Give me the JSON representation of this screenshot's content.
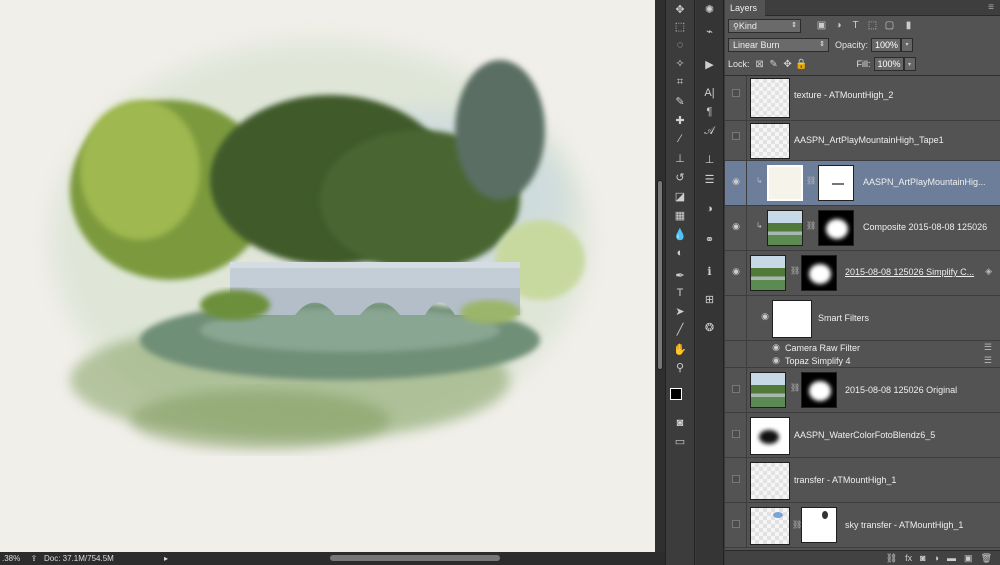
{
  "status": {
    "zoom": ".38%",
    "doc": "Doc: 37.1M/754.5M"
  },
  "layers_panel": {
    "tab_label": "Layers",
    "filter_kind": "Kind",
    "blend_mode": "Linear Burn",
    "opacity_label": "Opacity:",
    "opacity_value": "100%",
    "lock_label": "Lock:",
    "fill_label": "Fill:",
    "fill_value": "100%",
    "layers": [
      {
        "name": "texture - ATMountHigh_2",
        "visible": false
      },
      {
        "name": "AASPN_ArtPlayMountainHigh_Tape1",
        "visible": false
      },
      {
        "name": "AASPN_ArtPlayMountainHig...",
        "visible": true,
        "selected": true
      },
      {
        "name": "Composite 2015-08-08 125026",
        "visible": true
      },
      {
        "name": "2015-08-08 125026 Simplify C...",
        "visible": true
      },
      {
        "name": "Smart Filters",
        "visible": true
      },
      {
        "name": "Camera Raw Filter",
        "visible": true
      },
      {
        "name": "Topaz Simplify 4",
        "visible": true
      },
      {
        "name": "2015-08-08 125026 Original",
        "visible": false
      },
      {
        "name": "AASPN_WaterColorFotoBlendz6_5",
        "visible": false
      },
      {
        "name": "transfer - ATMountHigh_1",
        "visible": false
      },
      {
        "name": "sky transfer - ATMountHigh_1",
        "visible": false
      }
    ]
  },
  "icons": {
    "tools_a": [
      "move-tool-icon",
      "marquee-tool-icon",
      "lasso-tool-icon",
      "magic-wand-icon",
      "crop-tool-icon",
      "eyedropper-icon",
      "healing-brush-icon",
      "brush-tool-icon",
      "clone-stamp-icon",
      "history-brush-icon",
      "eraser-icon",
      "gradient-tool-icon",
      "blur-tool-icon",
      "dodge-tool-icon",
      "pen-tool-icon",
      "type-tool-icon",
      "path-selection-icon",
      "line-tool-icon",
      "hand-tool-icon",
      "zoom-tool-icon"
    ],
    "tools_b": [
      "compass-icon",
      "play-icon",
      "character-icon",
      "paragraph-icon",
      "glyph-icon",
      "stamp-icon",
      "sliders-icon",
      "adjustments-icon",
      "brush-preset-icon",
      "info-icon",
      "grid-icon",
      "styles-icon"
    ]
  }
}
